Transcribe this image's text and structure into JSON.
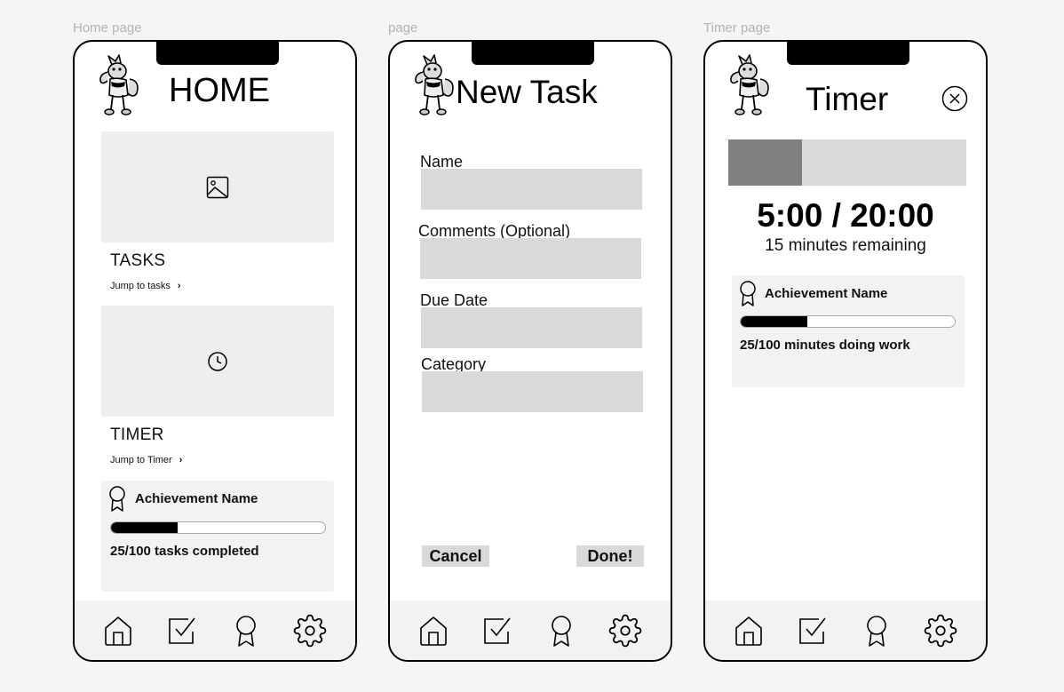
{
  "frames": {
    "home_label": "Home page",
    "new_task_label": "page",
    "timer_label": "Timer page"
  },
  "home": {
    "title": "HOME",
    "tasks_icon": "image-placeholder-icon",
    "tasks_title": "TASKS",
    "tasks_link": "Jump to tasks",
    "timer_icon": "clock-icon",
    "timer_title": "TIMER",
    "timer_link": "Jump to Timer",
    "achievement": {
      "name": "Achievement Name",
      "progress": 0.31,
      "text": "25/100 tasks completed"
    }
  },
  "new_task": {
    "title": "New Task",
    "fields": [
      {
        "label": "Name",
        "value": ""
      },
      {
        "label": "Comments (Optional)",
        "value": ""
      },
      {
        "label": "Due Date",
        "value": ""
      },
      {
        "label": "Category",
        "value": ""
      }
    ],
    "cancel_label": "Cancel",
    "done_label": "Done!"
  },
  "timer": {
    "title": "Timer",
    "close_icon": "close-circle-icon",
    "bar_progress": 0.31,
    "readout": "5:00 / 20:00",
    "remaining": "15 minutes remaining",
    "achievement": {
      "name": "Achievement Name",
      "progress": 0.31,
      "text": "25/100 minutes doing work"
    }
  },
  "nav": {
    "items": [
      {
        "icon": "home-icon"
      },
      {
        "icon": "checkbox-icon"
      },
      {
        "icon": "award-icon"
      },
      {
        "icon": "gear-icon"
      }
    ]
  },
  "colors": {
    "phone_border": "#000000",
    "placeholder": "#d9d9d9",
    "card": "#eeeeee",
    "progress_fill": "#000000",
    "timer_fill": "#808080"
  }
}
